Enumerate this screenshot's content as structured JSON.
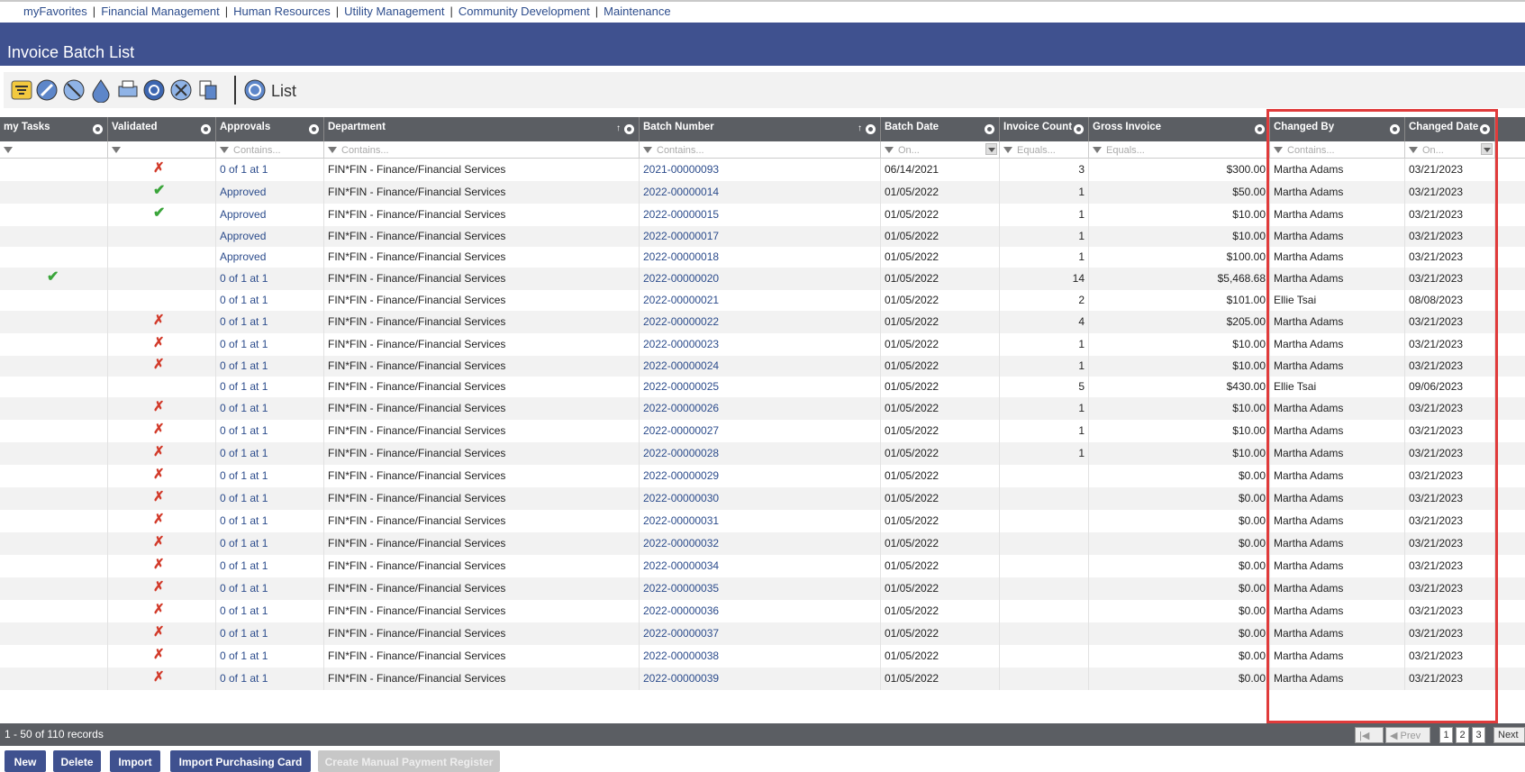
{
  "nav": {
    "items": [
      "myFavorites",
      "Financial Management",
      "Human Resources",
      "Utility Management",
      "Community Development",
      "Maintenance"
    ],
    "separator": "|"
  },
  "page_title": "Invoice Batch List",
  "toolbar": {
    "icons": [
      "list-filter-icon",
      "edit-icon",
      "clear-icon",
      "drop-icon",
      "print-icon",
      "refresh-icon",
      "tools-icon",
      "report-icon",
      "view-icon"
    ],
    "view_label": "List"
  },
  "columns": [
    "my Tasks",
    "Validated",
    "Approvals",
    "Department",
    "Batch Number",
    "Batch Date",
    "Invoice Count",
    "Gross Invoice",
    "Changed By",
    "Changed Date"
  ],
  "filters": [
    "",
    "",
    "Contains...",
    "Contains...",
    "Contains...",
    "On...",
    "Equals...",
    "Equals...",
    "Contains...",
    "On..."
  ],
  "rows": [
    {
      "task": "",
      "valid": "x",
      "appr": "0 of 1 at 1",
      "dept": "FIN*FIN - Finance/Financial Services",
      "batch": "2021-00000093",
      "date": "06/14/2021",
      "count": "3",
      "gross": "$300.00",
      "by": "Martha Adams",
      "cdate": "03/21/2023"
    },
    {
      "task": "",
      "valid": "check",
      "appr": "Approved",
      "dept": "FIN*FIN - Finance/Financial Services",
      "batch": "2022-00000014",
      "date": "01/05/2022",
      "count": "1",
      "gross": "$50.00",
      "by": "Martha Adams",
      "cdate": "03/21/2023"
    },
    {
      "task": "",
      "valid": "check",
      "appr": "Approved",
      "dept": "FIN*FIN - Finance/Financial Services",
      "batch": "2022-00000015",
      "date": "01/05/2022",
      "count": "1",
      "gross": "$10.00",
      "by": "Martha Adams",
      "cdate": "03/21/2023"
    },
    {
      "task": "",
      "valid": "",
      "appr": "Approved",
      "dept": "FIN*FIN - Finance/Financial Services",
      "batch": "2022-00000017",
      "date": "01/05/2022",
      "count": "1",
      "gross": "$10.00",
      "by": "Martha Adams",
      "cdate": "03/21/2023"
    },
    {
      "task": "",
      "valid": "",
      "appr": "Approved",
      "dept": "FIN*FIN - Finance/Financial Services",
      "batch": "2022-00000018",
      "date": "01/05/2022",
      "count": "1",
      "gross": "$100.00",
      "by": "Martha Adams",
      "cdate": "03/21/2023"
    },
    {
      "task": "check",
      "valid": "",
      "appr": "0 of 1 at 1",
      "dept": "FIN*FIN - Finance/Financial Services",
      "batch": "2022-00000020",
      "date": "01/05/2022",
      "count": "14",
      "gross": "$5,468.68",
      "by": "Martha Adams",
      "cdate": "03/21/2023"
    },
    {
      "task": "",
      "valid": "",
      "appr": "0 of 1 at 1",
      "dept": "FIN*FIN - Finance/Financial Services",
      "batch": "2022-00000021",
      "date": "01/05/2022",
      "count": "2",
      "gross": "$101.00",
      "by": "Ellie Tsai",
      "cdate": "08/08/2023"
    },
    {
      "task": "",
      "valid": "x",
      "appr": "0 of 1 at 1",
      "dept": "FIN*FIN - Finance/Financial Services",
      "batch": "2022-00000022",
      "date": "01/05/2022",
      "count": "4",
      "gross": "$205.00",
      "by": "Martha Adams",
      "cdate": "03/21/2023"
    },
    {
      "task": "",
      "valid": "x",
      "appr": "0 of 1 at 1",
      "dept": "FIN*FIN - Finance/Financial Services",
      "batch": "2022-00000023",
      "date": "01/05/2022",
      "count": "1",
      "gross": "$10.00",
      "by": "Martha Adams",
      "cdate": "03/21/2023"
    },
    {
      "task": "",
      "valid": "x",
      "appr": "0 of 1 at 1",
      "dept": "FIN*FIN - Finance/Financial Services",
      "batch": "2022-00000024",
      "date": "01/05/2022",
      "count": "1",
      "gross": "$10.00",
      "by": "Martha Adams",
      "cdate": "03/21/2023"
    },
    {
      "task": "",
      "valid": "",
      "appr": "0 of 1 at 1",
      "dept": "FIN*FIN - Finance/Financial Services",
      "batch": "2022-00000025",
      "date": "01/05/2022",
      "count": "5",
      "gross": "$430.00",
      "by": "Ellie Tsai",
      "cdate": "09/06/2023"
    },
    {
      "task": "",
      "valid": "x",
      "appr": "0 of 1 at 1",
      "dept": "FIN*FIN - Finance/Financial Services",
      "batch": "2022-00000026",
      "date": "01/05/2022",
      "count": "1",
      "gross": "$10.00",
      "by": "Martha Adams",
      "cdate": "03/21/2023"
    },
    {
      "task": "",
      "valid": "x",
      "appr": "0 of 1 at 1",
      "dept": "FIN*FIN - Finance/Financial Services",
      "batch": "2022-00000027",
      "date": "01/05/2022",
      "count": "1",
      "gross": "$10.00",
      "by": "Martha Adams",
      "cdate": "03/21/2023"
    },
    {
      "task": "",
      "valid": "x",
      "appr": "0 of 1 at 1",
      "dept": "FIN*FIN - Finance/Financial Services",
      "batch": "2022-00000028",
      "date": "01/05/2022",
      "count": "1",
      "gross": "$10.00",
      "by": "Martha Adams",
      "cdate": "03/21/2023"
    },
    {
      "task": "",
      "valid": "x",
      "appr": "0 of 1 at 1",
      "dept": "FIN*FIN - Finance/Financial Services",
      "batch": "2022-00000029",
      "date": "01/05/2022",
      "count": "",
      "gross": "$0.00",
      "by": "Martha Adams",
      "cdate": "03/21/2023"
    },
    {
      "task": "",
      "valid": "x",
      "appr": "0 of 1 at 1",
      "dept": "FIN*FIN - Finance/Financial Services",
      "batch": "2022-00000030",
      "date": "01/05/2022",
      "count": "",
      "gross": "$0.00",
      "by": "Martha Adams",
      "cdate": "03/21/2023"
    },
    {
      "task": "",
      "valid": "x",
      "appr": "0 of 1 at 1",
      "dept": "FIN*FIN - Finance/Financial Services",
      "batch": "2022-00000031",
      "date": "01/05/2022",
      "count": "",
      "gross": "$0.00",
      "by": "Martha Adams",
      "cdate": "03/21/2023"
    },
    {
      "task": "",
      "valid": "x",
      "appr": "0 of 1 at 1",
      "dept": "FIN*FIN - Finance/Financial Services",
      "batch": "2022-00000032",
      "date": "01/05/2022",
      "count": "",
      "gross": "$0.00",
      "by": "Martha Adams",
      "cdate": "03/21/2023"
    },
    {
      "task": "",
      "valid": "x",
      "appr": "0 of 1 at 1",
      "dept": "FIN*FIN - Finance/Financial Services",
      "batch": "2022-00000034",
      "date": "01/05/2022",
      "count": "",
      "gross": "$0.00",
      "by": "Martha Adams",
      "cdate": "03/21/2023"
    },
    {
      "task": "",
      "valid": "x",
      "appr": "0 of 1 at 1",
      "dept": "FIN*FIN - Finance/Financial Services",
      "batch": "2022-00000035",
      "date": "01/05/2022",
      "count": "",
      "gross": "$0.00",
      "by": "Martha Adams",
      "cdate": "03/21/2023"
    },
    {
      "task": "",
      "valid": "x",
      "appr": "0 of 1 at 1",
      "dept": "FIN*FIN - Finance/Financial Services",
      "batch": "2022-00000036",
      "date": "01/05/2022",
      "count": "",
      "gross": "$0.00",
      "by": "Martha Adams",
      "cdate": "03/21/2023"
    },
    {
      "task": "",
      "valid": "x",
      "appr": "0 of 1 at 1",
      "dept": "FIN*FIN - Finance/Financial Services",
      "batch": "2022-00000037",
      "date": "01/05/2022",
      "count": "",
      "gross": "$0.00",
      "by": "Martha Adams",
      "cdate": "03/21/2023"
    },
    {
      "task": "",
      "valid": "x",
      "appr": "0 of 1 at 1",
      "dept": "FIN*FIN - Finance/Financial Services",
      "batch": "2022-00000038",
      "date": "01/05/2022",
      "count": "",
      "gross": "$0.00",
      "by": "Martha Adams",
      "cdate": "03/21/2023"
    },
    {
      "task": "",
      "valid": "x",
      "appr": "0 of 1 at 1",
      "dept": "FIN*FIN - Finance/Financial Services",
      "batch": "2022-00000039",
      "date": "01/05/2022",
      "count": "",
      "gross": "$0.00",
      "by": "Martha Adams",
      "cdate": "03/21/2023"
    }
  ],
  "footer": {
    "records": "1 - 50 of 110 records",
    "prev_label": "Prev",
    "next_label": "Next",
    "pages": [
      "1",
      "2",
      "3"
    ]
  },
  "actions": {
    "new": "New",
    "delete": "Delete",
    "import": "Import",
    "import_pcard": "Import Purchasing Card",
    "create_register": "Create Manual Payment Register"
  },
  "colors": {
    "header_blue": "#3f518f",
    "grid_header": "#5b5e63",
    "link": "#2c4c8c",
    "highlight": "#e03b3b",
    "check": "#3aa53a",
    "cross": "#d23a2a"
  }
}
